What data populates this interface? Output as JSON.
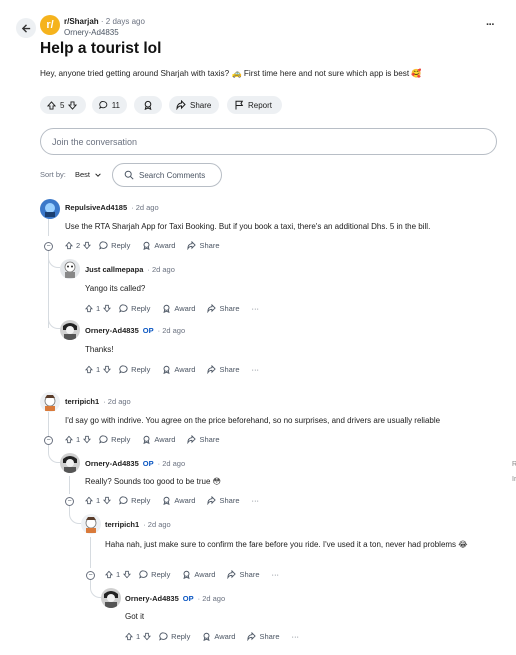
{
  "header": {
    "subreddit": "r/Sharjah",
    "time": "· 2 days ago",
    "author": "Ornery-Ad4835",
    "more": "···"
  },
  "post": {
    "title": "Help a tourist lol",
    "body": "Hey, anyone tried getting around Sharjah with taxis? 🚕 First time here and not sure which app is best 🥰",
    "votes": "5",
    "comments": "11",
    "share": "Share",
    "report": "Report"
  },
  "join_placeholder": "Join the conversation",
  "sort": {
    "label": "Sort by:",
    "value": "Best"
  },
  "search_comments": "Search Comments",
  "labels": {
    "reply": "Reply",
    "award": "Award",
    "share": "Share",
    "op": "OP",
    "more": "···"
  },
  "comments": [
    {
      "author": "RepulsiveAd4185",
      "time": "· 2d ago",
      "text": "Use the RTA Sharjah App for Taxi Booking. But if you book a taxi, there's an additional Dhs. 5 in the bill.",
      "votes": "2"
    },
    {
      "author": "Just callmepapa",
      "time": "· 2d ago",
      "text": "Yango its called?",
      "votes": "1"
    },
    {
      "author": "Ornery-Ad4835",
      "time": "· 2d ago",
      "text": "Thanks!",
      "votes": "1"
    },
    {
      "author": "terripich1",
      "time": "· 2d ago",
      "text": "I'd say go with indrive. You agree on the price beforehand, so no surprises, and drivers are usually reliable",
      "votes": "1"
    },
    {
      "author": "Ornery-Ad4835",
      "time": "· 2d ago",
      "text": "Really? Sounds too good to be true 😳",
      "votes": "1"
    },
    {
      "author": "terripich1",
      "time": "· 2d ago",
      "text": "Haha nah, just make sure to confirm the fare before you ride. I've used it a ton, never had problems 😂",
      "votes": "1"
    },
    {
      "author": "Ornery-Ad4835",
      "time": "· 2d ago",
      "text": "Got it",
      "votes": "1"
    }
  ],
  "edge_text": [
    "R",
    "Ir"
  ],
  "colors": {
    "subreddit_icon": "#f5b31d",
    "op": "#0a56c2",
    "pill": "#edf0f3"
  }
}
